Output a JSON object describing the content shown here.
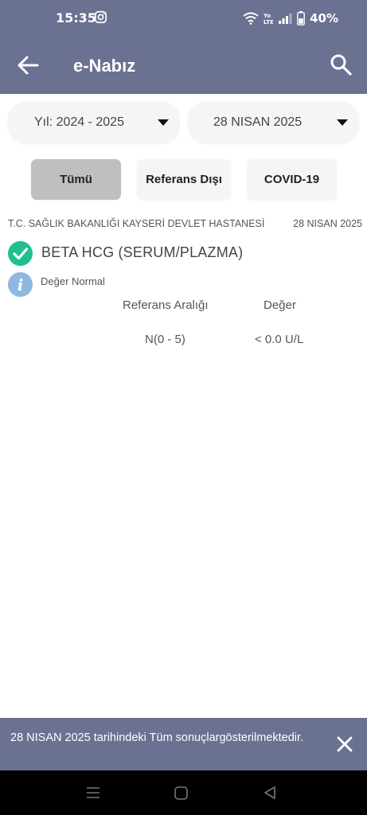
{
  "status_bar": {
    "time": "15:35",
    "battery": "40%",
    "icons": [
      "instagram-icon",
      "wifi-icon",
      "volte-icon",
      "signal-icon",
      "battery-icon"
    ]
  },
  "app_bar": {
    "title": "e-Nabız",
    "back_icon": "arrow-left-icon",
    "search_icon": "search-icon"
  },
  "filters": {
    "year_selected": "Yıl: 2024 - 2025",
    "date_selected": "28 NISAN 2025",
    "tabs": [
      {
        "label": "Tümü",
        "active": true
      },
      {
        "label": "Referans Dışı",
        "active": false
      },
      {
        "label": "COVID-19",
        "active": false
      }
    ]
  },
  "result": {
    "hospital": "T.C. SAĞLIK BAKANLIĞI KAYSERİ DEVLET HASTANESİ",
    "date": "28 NISAN 2025",
    "test_name": "BETA HCG (SERUM/PLAZMA)",
    "status": "Değer Normal",
    "columns": {
      "reference": "Referans Aralığı",
      "value": "Değer"
    },
    "reference_range": "N(0 - 5)",
    "value": "< 0.0 U/L"
  },
  "snackbar": {
    "message": "28 NISAN 2025 tarihindeki Tüm sonuçlargösterilmektedir."
  },
  "colors": {
    "primary": "#6b7191",
    "check_green": "#1fbf8f",
    "info_blue": "#8eb8e0",
    "active_tab": "#bfbfc1"
  }
}
